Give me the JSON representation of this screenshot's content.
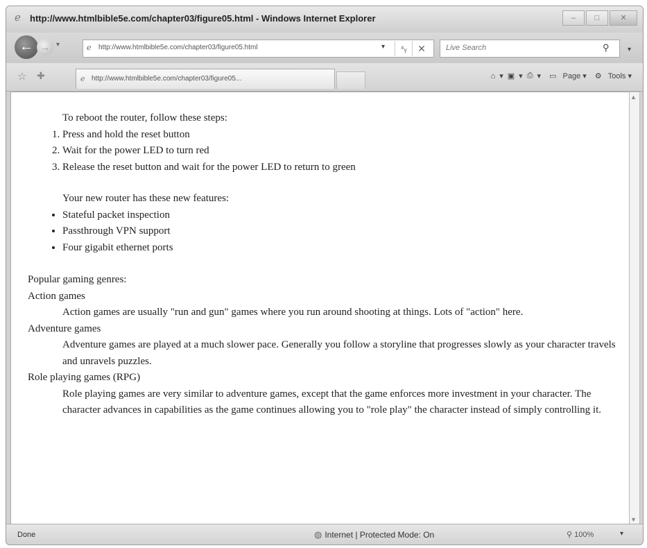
{
  "window": {
    "title": "http://www.htmlbible5e.com/chapter03/figure05.html - Windows Internet Explorer",
    "buttons": {
      "minimize": "–",
      "maximize": "□",
      "close": "✕"
    }
  },
  "address": {
    "url": "http://www.htmlbible5e.com/chapter03/figure05.html",
    "dropdown": "▾",
    "refresh": "⁴ᵧ",
    "stop": "✕"
  },
  "search": {
    "placeholder": "Live Search",
    "icon": "search-icon"
  },
  "tab": {
    "label": "http://www.htmlbible5e.com/chapter03/figure05..."
  },
  "tools": {
    "home": "⌂",
    "feeds": "▣",
    "print": "⎙",
    "page_label": "Page",
    "tools_label": "Tools"
  },
  "content": {
    "steps_intro": "To reboot the router, follow these steps:",
    "steps": [
      "Press and hold the reset button",
      "Wait for the power LED to turn red",
      "Release the reset button and wait for the power LED to return to green"
    ],
    "features_intro": "Your new router has these new features:",
    "features": [
      "Stateful packet inspection",
      "Passthrough VPN support",
      "Four gigabit ethernet ports"
    ],
    "genres_heading": "Popular gaming genres:",
    "genres": [
      {
        "term": "Action games",
        "definition": "Action games are usually \"run and gun\" games where you run around shooting at things. Lots of \"action\" here."
      },
      {
        "term": "Adventure games",
        "definition": "Adventure games are played at a much slower pace. Generally you follow a storyline that progresses slowly as your character travels and unravels puzzles."
      },
      {
        "term": "Role playing games (RPG)",
        "definition": "Role playing games are very similar to adventure games, except that the game enforces more investment in your character. The character advances in capabilities as the game continues allowing you to \"role play\" the character instead of simply controlling it."
      }
    ]
  },
  "status": {
    "text": "Done",
    "zone": "Internet | Protected Mode: On",
    "zoom": "100%"
  }
}
